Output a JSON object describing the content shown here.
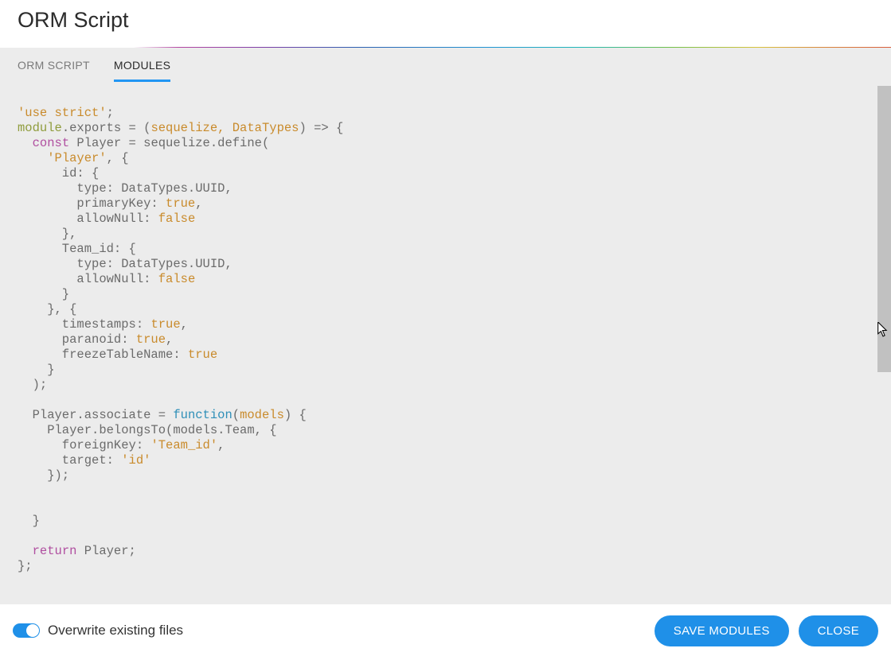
{
  "header": {
    "title": "ORM Script"
  },
  "tabs": [
    {
      "label": "ORM SCRIPT",
      "active": false
    },
    {
      "label": "MODULES",
      "active": true
    }
  ],
  "code": {
    "t_use_strict": "'use strict'",
    "t_module": "module",
    "t_exports_eq": ".exports = (",
    "t_params": "sequelize, DataTypes",
    "t_arrow": ") => {",
    "t_const": "const",
    "t_player_def": " Player = sequelize.define(",
    "t_player_str": "'Player'",
    "t_comma_brace": ", {",
    "t_id": "      id: {",
    "t_type_uuid": "        type: DataTypes.UUID,",
    "t_primary": "        primaryKey: ",
    "t_true": "true",
    "t_allownull": "        allowNull: ",
    "t_false": "false",
    "t_close_comma": "      },",
    "t_teamid": "      Team_id: {",
    "t_close": "      }",
    "t_close2": "    }, {",
    "t_timestamps": "      timestamps: ",
    "t_paranoid": "      paranoid: ",
    "t_freeze": "      freezeTableName: ",
    "t_brace4": "    }",
    "t_closep": "  );",
    "t_assoc": "  Player.associate = ",
    "t_function": "function",
    "t_lp": "(",
    "t_models": "models",
    "t_rp_brace": ") {",
    "t_belongs": "    Player.belongsTo(models.Team, {",
    "t_fk": "      foreignKey: ",
    "t_teamidstr": "'Team_id'",
    "t_target": "      target: ",
    "t_idstr": "'id'",
    "t_close_bp": "    });",
    "t_brace2": "  }",
    "t_return": "return",
    "t_ret_player": " Player;",
    "t_end": "};"
  },
  "footer": {
    "overwrite_label": "Overwrite existing files",
    "overwrite_on": true,
    "save_label": "SAVE MODULES",
    "close_label": "CLOSE"
  }
}
